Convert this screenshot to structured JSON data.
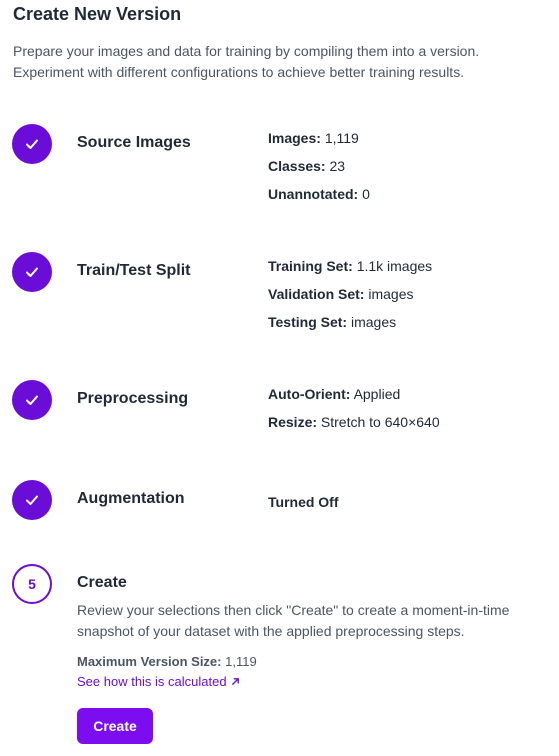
{
  "header": {
    "title": "Create New Version",
    "description": "Prepare your images and data for training by compiling them into a version. Experiment with different configurations to achieve better training results."
  },
  "colors": {
    "accent": "#6a0dd6",
    "button": "#7c0df0"
  },
  "steps": {
    "source": {
      "title": "Source Images",
      "icon": "check-icon",
      "details": [
        {
          "key": "Images:",
          "value": "1,119"
        },
        {
          "key": "Classes:",
          "value": "23"
        },
        {
          "key": "Unannotated:",
          "value": "0"
        }
      ]
    },
    "split": {
      "title": "Train/Test Split",
      "icon": "check-icon",
      "details": [
        {
          "key": "Training Set:",
          "value": "1.1k images"
        },
        {
          "key": "Validation Set:",
          "value": "images"
        },
        {
          "key": "Testing Set:",
          "value": "images"
        }
      ]
    },
    "preprocessing": {
      "title": "Preprocessing",
      "icon": "check-icon",
      "details": [
        {
          "key": "Auto-Orient:",
          "value": "Applied"
        },
        {
          "key": "Resize:",
          "value": "Stretch to 640×640"
        }
      ]
    },
    "augmentation": {
      "title": "Augmentation",
      "icon": "check-icon",
      "status": "Turned Off"
    },
    "create": {
      "number": "5",
      "title": "Create",
      "description": "Review your selections then click \"Create\" to create a moment-in-time snapshot of your dataset with the applied preprocessing steps.",
      "max_size_label": "Maximum Version Size:",
      "max_size_value": "1,119",
      "calc_link": "See how this is calculated",
      "calc_link_icon": "external-arrow-icon",
      "button_label": "Create"
    }
  }
}
